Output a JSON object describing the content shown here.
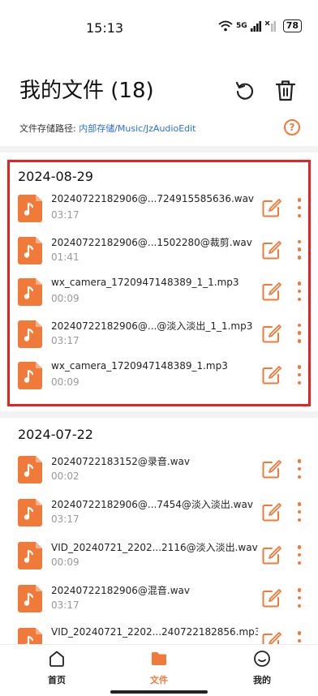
{
  "status_bar": {
    "time": "15:13",
    "network": "5G",
    "battery": "78"
  },
  "header": {
    "title": "我的文件 (18)"
  },
  "path": {
    "label": "文件存储路径: ",
    "value": "内部存储/Music/JzAudioEdit"
  },
  "colors": {
    "accent": "#f07a3a",
    "highlight_border": "#e8231f",
    "link": "#2a6fdb"
  },
  "groups": [
    {
      "date": "2024-08-29",
      "files": [
        {
          "name": "20240722182906@...724915585636.wav",
          "duration": "03:17"
        },
        {
          "name": "20240722182906@...1502280@裁剪.wav",
          "duration": "01:41"
        },
        {
          "name": "wx_camera_1720947148389_1_1.mp3",
          "duration": "00:09"
        },
        {
          "name": "20240722182906@...@淡入淡出_1_1.mp3",
          "duration": "03:17"
        },
        {
          "name": "wx_camera_1720947148389_1.mp3",
          "duration": "00:09"
        }
      ]
    },
    {
      "date": "2024-07-22",
      "files": [
        {
          "name": "20240722183152@录音.wav",
          "duration": "00:02"
        },
        {
          "name": "20240722182906@...7454@淡入淡出.wav",
          "duration": "03:17"
        },
        {
          "name": "VID_20240721_2202...2116@淡入淡出.wav",
          "duration": "00:09"
        },
        {
          "name": "20240722182906@混音.wav",
          "duration": "03:17"
        },
        {
          "name": "VID_20240721_2202...240722182856.mp3",
          "duration": ""
        }
      ]
    }
  ],
  "bottom_nav": {
    "items": [
      {
        "label": "首页",
        "icon": "home-icon",
        "active": false
      },
      {
        "label": "文件",
        "icon": "folder-icon",
        "active": true
      },
      {
        "label": "我的",
        "icon": "smiley-icon",
        "active": false
      }
    ]
  }
}
